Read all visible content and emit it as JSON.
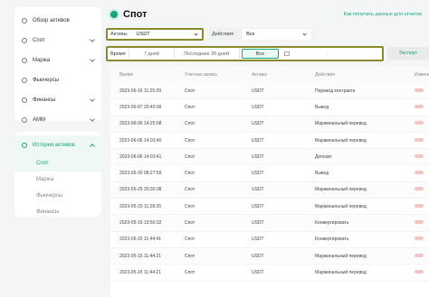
{
  "sidebar": {
    "items": [
      {
        "label": "Обзор активов",
        "icon": "overview-icon",
        "expandable": false
      },
      {
        "label": "Спот",
        "icon": "spot-icon",
        "expandable": true
      },
      {
        "label": "Маржа",
        "icon": "margin-icon",
        "expandable": true
      },
      {
        "label": "Фьючерсы",
        "icon": "futures-icon",
        "expandable": false
      },
      {
        "label": "Финансы",
        "icon": "finance-icon",
        "expandable": true
      },
      {
        "label": "AMM",
        "icon": "amm-icon",
        "expandable": true
      }
    ],
    "history": {
      "label": "История активов",
      "icon": "history-icon",
      "subitems": [
        "Спот",
        "Маржа",
        "Фьючерсы",
        "Финансы"
      ],
      "active_index": 0
    }
  },
  "header": {
    "title": "Спот",
    "help_link": "Как получить данные для отчетов"
  },
  "filters": {
    "assets_label": "Активы",
    "assets_value": "USDT",
    "actions_label": "Действия",
    "actions_value": "Все",
    "time_label": "Время",
    "period_7": "7 дней",
    "period_30": "Последние 30 дней",
    "period_all": "Все",
    "date_separator": "-",
    "export_label": "Экспорт"
  },
  "table": {
    "columns": [
      "Время",
      "Учетная запись",
      "Активы",
      "Действия",
      "Изменения"
    ],
    "rows": [
      {
        "time": "2023-06-16 11:25:29",
        "account": "Спот",
        "asset": "USDT",
        "action": "Перевод контракта"
      },
      {
        "time": "2023-06-07 20:40:36",
        "account": "Спот",
        "asset": "USDT",
        "action": "Вывод"
      },
      {
        "time": "2023-06-06 14:25:08",
        "account": "Спот",
        "asset": "USDT",
        "action": "Маржинальный перевод"
      },
      {
        "time": "2023-06-06 14:03:40",
        "account": "Спот",
        "asset": "USDT",
        "action": "Маржинальный перевод"
      },
      {
        "time": "2023-06-06 14:03:41",
        "account": "Спот",
        "asset": "USDT",
        "action": "Депозит"
      },
      {
        "time": "2023-05-30 08:27:59",
        "account": "Спот",
        "asset": "USDT",
        "action": "Вывод"
      },
      {
        "time": "2023-05-25 20:30:38",
        "account": "Спот",
        "asset": "USDT",
        "action": "Маржинальный перевод"
      },
      {
        "time": "2023-05-20 11:28:25",
        "account": "Спот",
        "asset": "USDT",
        "action": "Маржинальный перевод"
      },
      {
        "time": "2023-05-15 19:50:32",
        "account": "Спот",
        "asset": "USDT",
        "action": "Конвертировать"
      },
      {
        "time": "2023-05-15 11:44:41",
        "account": "Спот",
        "asset": "USDT",
        "action": "Конвертировать"
      },
      {
        "time": "2023-05-15 11:44:21",
        "account": "Спот",
        "asset": "USDT",
        "action": "Маржинальный перевод"
      },
      {
        "time": "2023-05-15 11:44:21",
        "account": "Спот",
        "asset": "USDT",
        "action": "Маржинальный перевод"
      }
    ]
  },
  "colors": {
    "accent": "#1aa37a",
    "highlight_border": "#8a8a2a",
    "change_bar": "#f3c5c5"
  }
}
